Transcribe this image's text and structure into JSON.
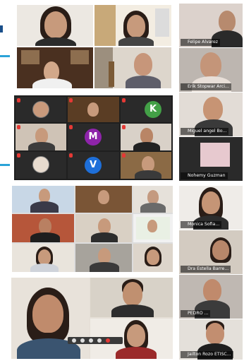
{
  "colors": {
    "accent": "#2ba3d8",
    "muted_mic": "#e53935",
    "avatar_k": "#43a047",
    "avatar_m": "#8e24aa",
    "avatar_v": "#1e6fd9"
  },
  "avatars": {
    "k": "K",
    "m": "M",
    "v": "V"
  },
  "right_column": [
    {
      "name": "Felipe Alvarez"
    },
    {
      "name": "Erik Stopwar Arci..."
    },
    {
      "name": "Miguel angel Bo..."
    },
    {
      "name": "Nohemy Guzman"
    },
    {
      "name": "Monica Sofia..."
    },
    {
      "name": "Dra Estella Barre..."
    },
    {
      "name": "PEDRO ..."
    },
    {
      "name": "Jailton Rozo ETISC..."
    }
  ]
}
